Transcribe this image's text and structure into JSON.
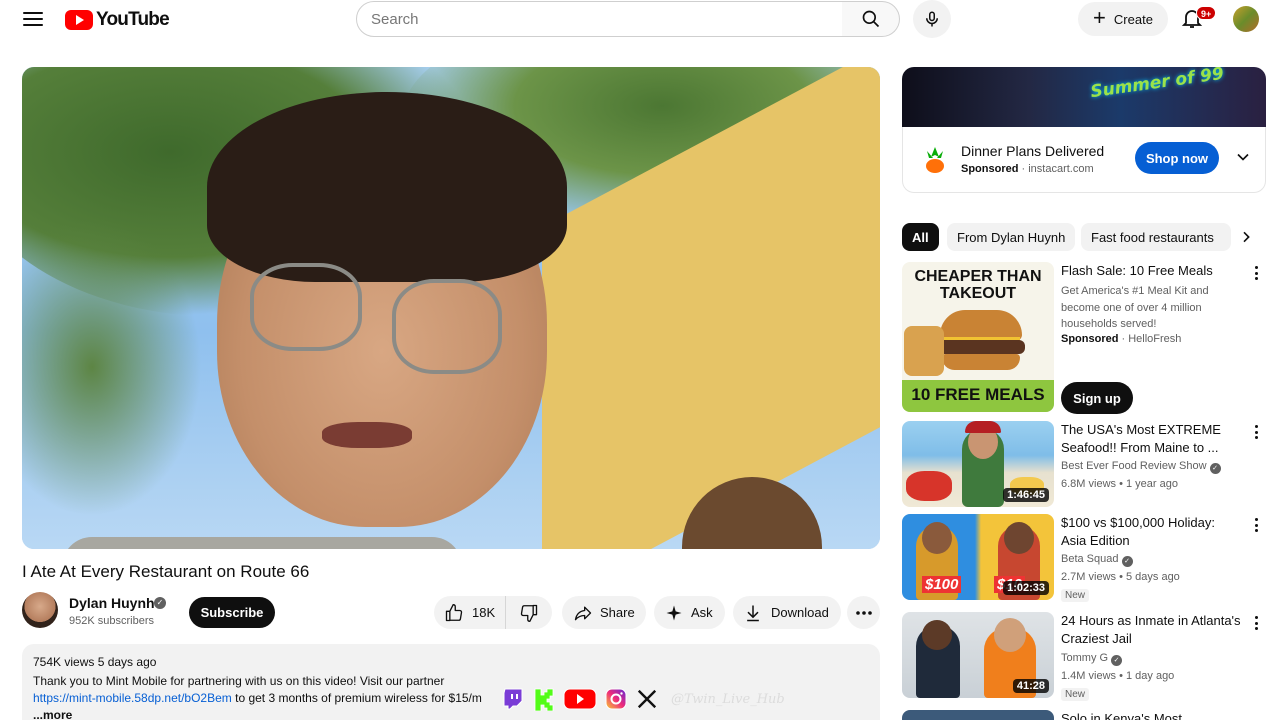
{
  "header": {
    "logo_text": "YouTube",
    "search_placeholder": "Search",
    "create_label": "Create",
    "notifications_badge": "9+"
  },
  "video": {
    "title": "I Ate At Every Restaurant on Route 66",
    "channel": {
      "name": "Dylan Huynh",
      "subscribers": "952K subscribers",
      "subscribe_label": "Subscribe"
    },
    "actions": {
      "likes": "18K",
      "share": "Share",
      "ask": "Ask",
      "download": "Download"
    },
    "description": {
      "meta": "754K views  5 days ago",
      "line1": "Thank you to Mint Mobile for partnering with us on this video! Visit our partner",
      "link": "https://mint-mobile.58dp.net/bO2Bem",
      "line2_rest": " to get 3 months of premium wireless for $15/m",
      "more": "...more"
    },
    "overlay_handle": "@Twin_Live_Hub"
  },
  "ad": {
    "banner_text": "Summer of 99",
    "title": "Dinner Plans Delivered",
    "sponsored": "Sponsored",
    "domain": "instacart.com",
    "cta": "Shop now"
  },
  "chips": [
    "All",
    "From Dylan Huynh",
    "Fast food restaurants"
  ],
  "recommendations": [
    {
      "title": "Flash Sale: 10 Free Meals",
      "description": "Get America's #1 Meal Kit and become one of over 4 million households served!",
      "sponsored": "Sponsored",
      "advertiser": "HelloFresh",
      "cta": "Sign up",
      "thumb_top": "CHEAPER THAN TAKEOUT",
      "thumb_bottom": "10 FREE MEALS"
    },
    {
      "title": "The USA's Most EXTREME Seafood!! From Maine to ...",
      "channel": "Best Ever Food Review Show",
      "meta": "6.8M views • 1 year ago",
      "duration": "1:46:45"
    },
    {
      "title": "$100 vs $100,000 Holiday: Asia Edition",
      "channel": "Beta Squad",
      "meta": "2.7M views • 5 days ago",
      "duration": "1:02:33",
      "badge": "New",
      "thumb_left": "$100",
      "thumb_right": "$10"
    },
    {
      "title": "24 Hours as Inmate in Atlanta's Craziest Jail",
      "channel": "Tommy G",
      "meta": "1.4M views • 1 day ago",
      "duration": "41:28",
      "badge": "New"
    },
    {
      "title": "Solo in Kenya's Most Dangerous"
    }
  ],
  "colors": {
    "brand_red": "#ff0000",
    "link_blue": "#065fd4",
    "text_primary": "#0f0f0f",
    "text_secondary": "#606060",
    "chip_bg": "#f2f2f2"
  },
  "icons": [
    "menu-icon",
    "youtube-logo-icon",
    "search-icon",
    "mic-icon",
    "plus-icon",
    "bell-icon",
    "like-icon",
    "dislike-icon",
    "share-icon",
    "sparkle-icon",
    "download-icon",
    "more-horizontal-icon",
    "verified-icon",
    "chevron-down-icon",
    "chevron-right-icon",
    "more-vertical-icon",
    "twitch-icon",
    "kick-icon",
    "youtube-icon",
    "instagram-icon",
    "x-icon"
  ]
}
